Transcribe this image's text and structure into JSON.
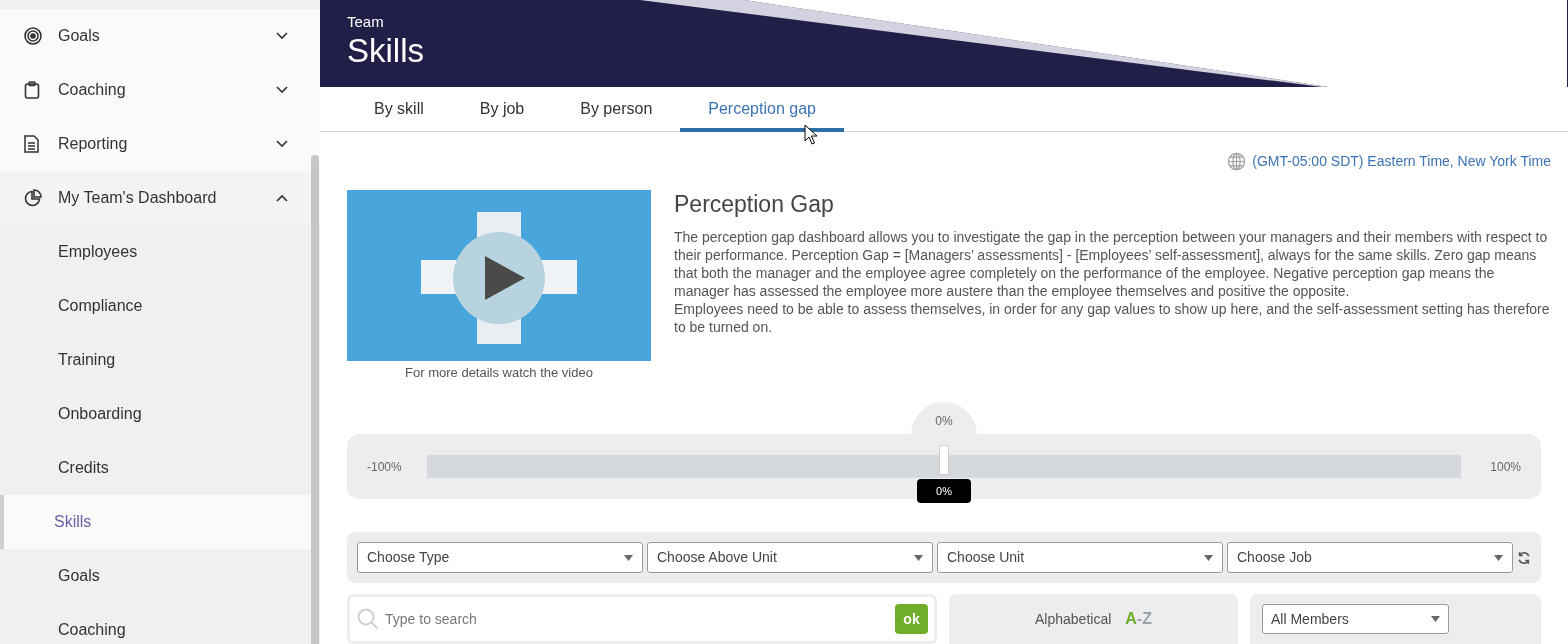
{
  "sidebar": {
    "items": [
      {
        "label": "Goals",
        "selected": false,
        "expanded": false
      },
      {
        "label": "Coaching",
        "selected": false,
        "expanded": false
      },
      {
        "label": "Reporting",
        "selected": false,
        "expanded": false
      },
      {
        "label": "My Team's Dashboard",
        "selected": false,
        "expanded": true,
        "children": [
          {
            "label": "Employees",
            "selected": false
          },
          {
            "label": "Compliance",
            "selected": false
          },
          {
            "label": "Training",
            "selected": false
          },
          {
            "label": "Onboarding",
            "selected": false
          },
          {
            "label": "Credits",
            "selected": false
          },
          {
            "label": "Skills",
            "selected": true
          },
          {
            "label": "Goals",
            "selected": false
          },
          {
            "label": "Coaching",
            "selected": false
          }
        ]
      }
    ]
  },
  "header": {
    "subtitle": "Team",
    "title": "Skills"
  },
  "tabs": [
    {
      "label": "By skill",
      "selected": false
    },
    {
      "label": "By job",
      "selected": false
    },
    {
      "label": "By person",
      "selected": false
    },
    {
      "label": "Perception gap",
      "selected": true
    }
  ],
  "timezone": "(GMT-05:00 SDT) Eastern Time, New York Time",
  "video": {
    "kind": "picture",
    "caption": "For more details watch the video"
  },
  "intro": {
    "title": "Perception Gap",
    "paragraphs": [
      "The perception gap dashboard allows you to investigate the gap in the perception between your managers and their members with respect to their performance. Perception Gap = [Managers’ assessments] - [Employees’ self-assessment], always for the same skills. Zero gap means that both the manager and the employee agree completely on the performance of the employee. Negative perception gap means the manager has assessed the employee more austere than the employee themselves and positive the opposite.",
      "Employees need to be able to assess themselves, in order for any gap values to show up here, and the self-assessment setting has therefore to be turned on."
    ]
  },
  "gap_slider": {
    "min_label": "-100%",
    "max_label": "100%",
    "top_value": "0%",
    "thumb_value": "0%",
    "level": 0.5
  },
  "filters": [
    "Choose Type",
    "Choose Above Unit",
    "Choose Unit",
    "Choose Job"
  ],
  "search": {
    "placeholder": "Type to search",
    "button": "ok"
  },
  "sort": {
    "label": "Alphabetical",
    "first": "A",
    "rest": "-Z"
  },
  "members_select": "All Members"
}
